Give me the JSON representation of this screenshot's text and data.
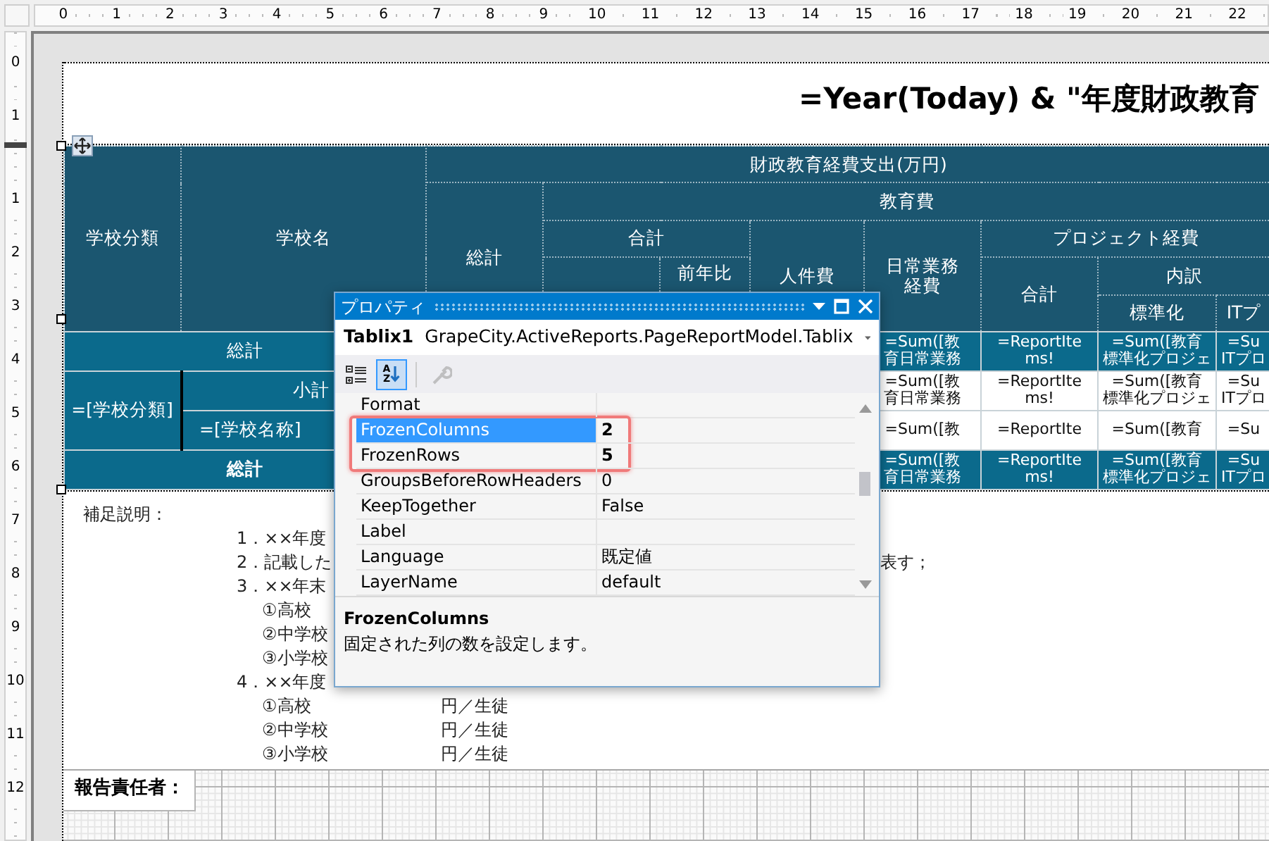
{
  "rulers": {
    "horizontal": [
      "0",
      "1",
      "2",
      "3",
      "4",
      "5",
      "6",
      "7",
      "8",
      "9",
      "10",
      "11",
      "12",
      "13",
      "14",
      "15",
      "16",
      "17",
      "18",
      "19",
      "20",
      "21",
      "22"
    ],
    "vertical_sections": [
      [
        "0",
        "1"
      ],
      [
        "1",
        "2",
        "3",
        "4",
        "5",
        "6",
        "7",
        "8",
        "9",
        "10",
        "11",
        "12"
      ]
    ]
  },
  "report": {
    "title": "=Year(Today) & \"年度財政教育",
    "table": {
      "columns": [
        {
          "label": "学校分類"
        },
        {
          "label": "学校名"
        },
        {
          "label": "財政教育経費支出(万円)",
          "children": [
            {
              "label": "総計"
            },
            {
              "label": "教育費",
              "children": [
                {
                  "label": "合計",
                  "children": [
                    {
                      "kind": "covered"
                    },
                    {
                      "kind": "header",
                      "label": "前年比"
                    }
                  ]
                },
                {
                  "label": "人件費"
                },
                {
                  "lines": [
                    "日常業務",
                    "経費"
                  ]
                },
                {
                  "label": "プロジェクト経費",
                  "children": [
                    {
                      "label": "合計"
                    },
                    {
                      "label": "内訳",
                      "children": [
                        {
                          "label": "標準化"
                        },
                        {
                          "label": "ITプ"
                        }
                      ]
                    }
                  ]
                }
              ]
            }
          ]
        }
      ],
      "rows": [
        {
          "kind": "total",
          "bold": false,
          "label": "総計",
          "values": [
            {
              "lines": [
                "=Sum([教",
                "育日常業務"
              ]
            },
            {
              "lines": [
                "=ReportIte",
                "ms!"
              ]
            },
            {
              "lines": [
                "=Sum([教育",
                "標準化プロジェ"
              ]
            },
            {
              "lines": [
                "=Su",
                "ITプロ"
              ]
            }
          ]
        },
        {
          "kind": "group",
          "label": "=[学校分類]",
          "children": [
            {
              "kind": "subtotal",
              "label": "小計",
              "values": [
                {
                  "lines": [
                    "=Sum([教",
                    "育日常業務"
                  ]
                },
                {
                  "lines": [
                    "=ReportIte",
                    "ms!"
                  ]
                },
                {
                  "lines": [
                    "=Sum([教育",
                    "標準化プロジェ"
                  ]
                },
                {
                  "lines": [
                    "=Su",
                    "ITプロ"
                  ]
                }
              ]
            },
            {
              "kind": "detail",
              "label": "=[学校名称]",
              "values": [
                {
                  "lines": [
                    "=Sum([教"
                  ]
                },
                {
                  "lines": [
                    "=ReportIte"
                  ]
                },
                {
                  "lines": [
                    "=Sum([教育"
                  ]
                },
                {
                  "lines": [
                    "=Su"
                  ]
                }
              ]
            }
          ]
        },
        {
          "kind": "total",
          "bold": true,
          "label": "総計",
          "values": [
            {
              "lines": [
                "=Sum([教",
                "育日常業務"
              ]
            },
            {
              "lines": [
                "=ReportIte",
                "ms!"
              ]
            },
            {
              "lines": [
                "=Sum([教育",
                "標準化プロジェ"
              ]
            },
            {
              "lines": [
                "=Su",
                "ITプロ"
              ]
            }
          ]
        }
      ]
    },
    "notes": {
      "heading": "補足説明：",
      "lines": [
        {
          "parts": [
            {
              "kind": "number",
              "text": "1．××年度"
            }
          ]
        },
        {
          "parts": [
            {
              "kind": "number",
              "text": "2．記載した"
            },
            {
              "kind": "tail",
              "text": "表す；"
            }
          ]
        },
        {
          "parts": [
            {
              "kind": "number",
              "text": "3．××年末"
            }
          ]
        },
        {
          "parts": [
            {
              "kind": "sub",
              "text": "①高校"
            }
          ]
        },
        {
          "parts": [
            {
              "kind": "sub",
              "text": "②中学校"
            }
          ]
        },
        {
          "parts": [
            {
              "kind": "sub",
              "text": "③小学校"
            }
          ]
        },
        {
          "parts": [
            {
              "kind": "number",
              "text": "4．××年度"
            }
          ]
        },
        {
          "parts": [
            {
              "kind": "sub",
              "text": "①高校"
            },
            {
              "kind": "unit",
              "text": "円／生徒"
            }
          ]
        },
        {
          "parts": [
            {
              "kind": "sub",
              "text": "②中学校"
            },
            {
              "kind": "unit",
              "text": "円／生徒"
            }
          ]
        },
        {
          "parts": [
            {
              "kind": "sub",
              "text": "③小学校"
            },
            {
              "kind": "unit",
              "text": "円／生徒"
            }
          ]
        }
      ]
    },
    "footer": {
      "label": "報告責任者："
    }
  },
  "properties_window": {
    "title": "プロパティ",
    "object_name": "Tablix1",
    "object_type": "GrapeCity.ActiveReports.PageReportModel.Tablix",
    "toolbar": [
      {
        "kind": "categorized",
        "selected": false,
        "disabled": false
      },
      {
        "kind": "alphabetical",
        "selected": true,
        "disabled": false,
        "icon_text": [
          "A",
          "Z"
        ]
      },
      {
        "kind": "property_pages",
        "selected": false,
        "disabled": true
      }
    ],
    "properties": [
      {
        "name": "Format",
        "selected": false,
        "highlighted": false
      },
      {
        "name": "FrozenColumns",
        "value": "2",
        "selected": true,
        "modified": true,
        "highlighted": true
      },
      {
        "name": "FrozenRows",
        "value": "5",
        "selected": false,
        "modified": true,
        "highlighted": true
      },
      {
        "name": "GroupsBeforeRowHeaders",
        "value": "0",
        "selected": false,
        "modified": false,
        "highlighted": false
      },
      {
        "name": "KeepTogether",
        "value": "False",
        "selected": false,
        "modified": false,
        "highlighted": false
      },
      {
        "name": "Label",
        "selected": false,
        "highlighted": false
      },
      {
        "name": "Language",
        "value": "既定値",
        "selected": false,
        "modified": false,
        "highlighted": false
      },
      {
        "name": "LayerName",
        "value": "default",
        "selected": false,
        "modified": false,
        "highlighted": false
      }
    ],
    "description": {
      "title": "FrozenColumns",
      "text": "固定された列の数を設定します。"
    }
  }
}
